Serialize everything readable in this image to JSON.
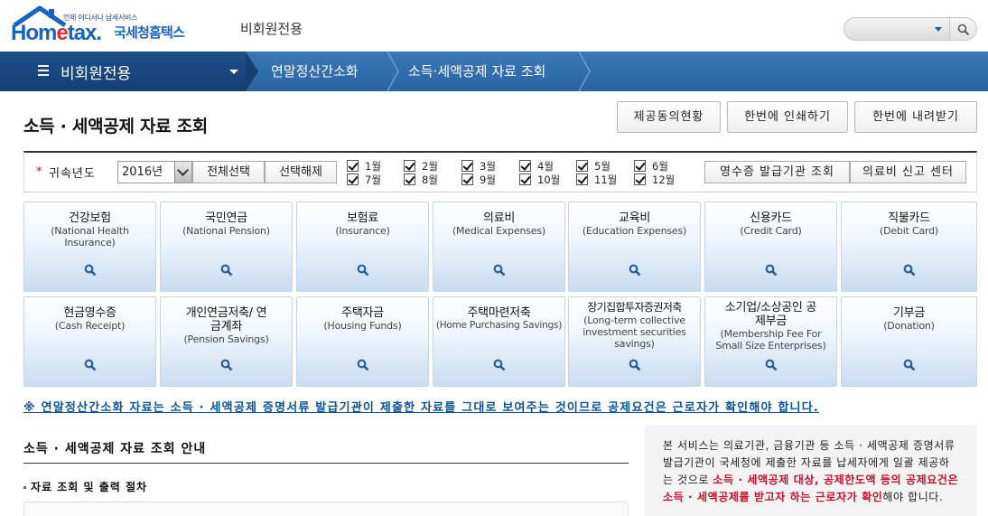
{
  "header": {
    "logo_tagline": "언제 어디서나 납세서비스",
    "logo_text_pre": "Hom",
    "logo_text_e": "e",
    "logo_text_post": "tax.",
    "logo_kr": "국세청홈택스",
    "mode_label": "비회원전용",
    "search_icon": "search-icon"
  },
  "nav": {
    "menu_label": "비회원전용",
    "crumbs": [
      "연말정산간소화",
      "소득·세액공제 자료 조회"
    ],
    "colors": {
      "bar": "#2f6bad",
      "first": "#1a4880"
    }
  },
  "page": {
    "title": "소득 · 세액공제 자료 조회",
    "buttons": [
      "제공동의현황",
      "한번에 인쇄하기",
      "한번에 내려받기"
    ]
  },
  "filter": {
    "year_label": "귀속년도",
    "year_value": "2016년",
    "select_all": "전체선택",
    "deselect_all": "선택해제",
    "months": [
      "1월",
      "2월",
      "3월",
      "4월",
      "5월",
      "6월",
      "7월",
      "8월",
      "9월",
      "10월",
      "11월",
      "12월"
    ],
    "receipt_issuer_btn": "영수증 발급기관 조회",
    "medical_center_btn": "의료비 신고 센터"
  },
  "cards": [
    {
      "title": "건강보험",
      "sub": "(National Health Insurance)"
    },
    {
      "title": "국민연금",
      "sub": "(National Pension)"
    },
    {
      "title": "보험료",
      "sub": "(Insurance)"
    },
    {
      "title": "의료비",
      "sub": "(Medical Expenses)"
    },
    {
      "title": "교육비",
      "sub": "(Education Expenses)"
    },
    {
      "title": "신용카드",
      "sub": "(Credit Card)"
    },
    {
      "title": "직불카드",
      "sub": "(Debit Card)"
    },
    {
      "title": "현금영수증",
      "sub": "(Cash Receipt)"
    },
    {
      "title": "개인연금저축/ 연금계좌",
      "sub": "(Pension Savings)"
    },
    {
      "title": "주택자금",
      "sub": "(Housing Funds)"
    },
    {
      "title": "주택마련저축",
      "sub": "(Home Purchasing Savings)"
    },
    {
      "title": "장기집합투자증권저축",
      "sub": "(Long-term collective investment securities savings)"
    },
    {
      "title": "소기업/소상공인 공제부금",
      "sub": "(Membership Fee For Small Size Enterprises)"
    },
    {
      "title": "기부금",
      "sub": "(Donation)"
    }
  ],
  "notice": "※ 연말정산간소화 자료는 소득 · 세액공제 증명서류 발급기관이 제출한 자료를 그대로 보여주는 것이므로 공제요건은 근로자가 확인해야 합니다.",
  "guide": {
    "title": "소득 · 세액공제 자료 조회 안내",
    "subtitle": "자료 조회 및 출력 절차"
  },
  "info": {
    "text1": "본 서비스는 의료기관, 금융기관 등 소득 · 세액공제 증명서류 발급기관이 국세청에 제출한 자료를 납세자에게 일괄 제공하는 것으로 ",
    "text_red": "소득 · 세액공제 대상, 공제한도액 등의 공제요건은 소득 · 세액공제를 받고자 하는 근로자가 확인",
    "text2": "해야 합니다."
  }
}
